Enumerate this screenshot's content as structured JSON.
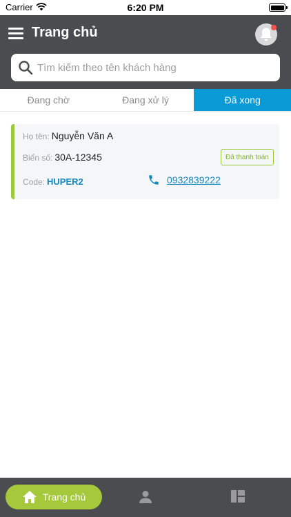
{
  "status_bar": {
    "carrier": "Carrier",
    "time": "6:20 PM"
  },
  "header": {
    "title": "Trang chủ"
  },
  "search": {
    "placeholder": "Tìm kiếm theo tên khách hàng",
    "value": ""
  },
  "tabs": [
    {
      "label": "Đang chờ",
      "active": false
    },
    {
      "label": "Đang xử lý",
      "active": false
    },
    {
      "label": "Đã xong",
      "active": true
    }
  ],
  "orders": [
    {
      "name_label": "Họ tên:",
      "name": "Nguyễn Văn A",
      "plate_label": "Biển số:",
      "plate": "30A-12345",
      "status": "Đã thanh toán",
      "code_label": "Code:",
      "code": "HUPER2",
      "phone": "0932839222"
    }
  ],
  "bottom_nav": {
    "home_label": "Trang chủ"
  },
  "colors": {
    "header": "#4a4c4f",
    "active_tab": "#0a9ad6",
    "accent_green": "#9bc93a",
    "link_blue": "#1389c1",
    "notification_dot": "#ef5350"
  },
  "icons": [
    "wifi-icon",
    "battery-icon",
    "menu-icon",
    "bell-icon",
    "search-icon",
    "phone-icon",
    "home-icon",
    "person-icon",
    "grid-icon"
  ]
}
